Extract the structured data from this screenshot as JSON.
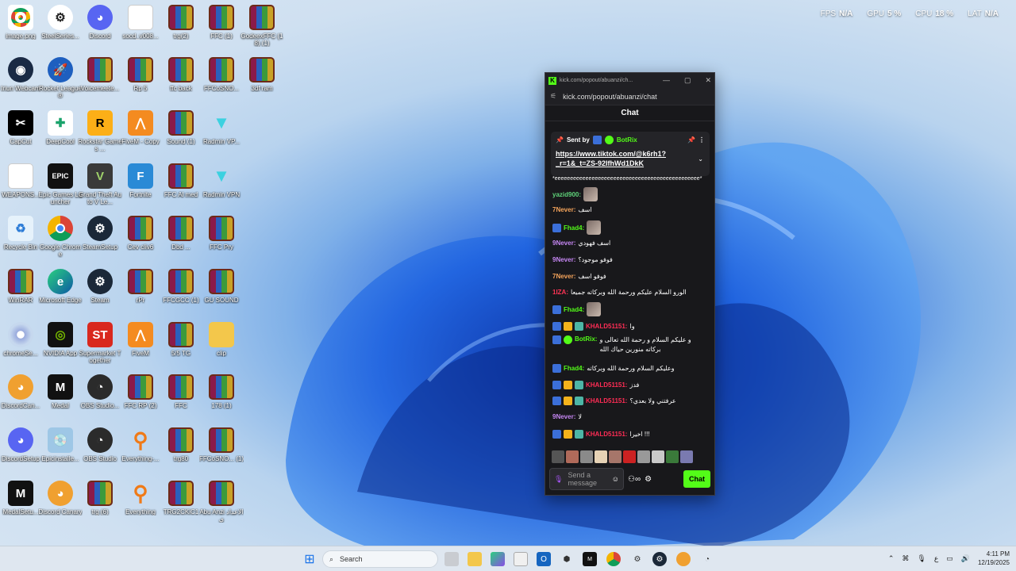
{
  "perf": {
    "fps_label": "FPS",
    "fps_value": "N/A",
    "gpu_label": "GPU",
    "gpu_value": "5 %",
    "cpu_label": "CPU",
    "cpu_value": "18 %",
    "lat_label": "LAT",
    "lat_value": "N/A"
  },
  "desktop_icons": [
    {
      "label": "image.png",
      "icon": "chrome-icon"
    },
    {
      "label": "SteelSeries...",
      "icon": "steelseries-icon"
    },
    {
      "label": "Discord",
      "icon": "discord-icon"
    },
    {
      "label": "socd_v008...",
      "icon": "file-icon"
    },
    {
      "label": "trg(2)",
      "icon": "rar-icon"
    },
    {
      "label": "FFC (1)",
      "icon": "rar-icon"
    },
    {
      "label": "GodeexFFC (18) (1)",
      "icon": "rar-icon"
    },
    {
      "label": "Iriun Webcam",
      "icon": "iriun-icon"
    },
    {
      "label": "Rocket League®",
      "icon": "rocket-league-icon"
    },
    {
      "label": "Voicemeete...",
      "icon": "rar-icon"
    },
    {
      "label": "Rp 5",
      "icon": "rar-icon"
    },
    {
      "label": "ffc back",
      "icon": "rar-icon"
    },
    {
      "label": "FFCoSNO...",
      "icon": "rar-icon"
    },
    {
      "label": "3df ram",
      "icon": "rar-icon"
    },
    {
      "label": "CapCut",
      "icon": "capcut-icon"
    },
    {
      "label": "DeepCool",
      "icon": "deepcool-icon"
    },
    {
      "label": "Rockstar Games ...",
      "icon": "rockstar-icon"
    },
    {
      "label": "FiveM - Copy",
      "icon": "fivem-icon"
    },
    {
      "label": "Sound (1)",
      "icon": "rar-icon"
    },
    {
      "label": "Radmin VP...",
      "icon": "radmin-icon"
    },
    {
      "label": "WEAPONS...",
      "icon": "file-icon"
    },
    {
      "label": "Epic Games Launcher",
      "icon": "epic-icon"
    },
    {
      "label": "Grand Theft Auto V Le...",
      "icon": "gta-icon"
    },
    {
      "label": "Fortnite",
      "icon": "fortnite-icon"
    },
    {
      "label": "FFC Al med",
      "icon": "rar-icon"
    },
    {
      "label": "Radmin VPN",
      "icon": "radmin-icon"
    },
    {
      "label": "Recycle Bin",
      "icon": "recycle-bin-icon"
    },
    {
      "label": "Google Chrome",
      "icon": "chrome-icon"
    },
    {
      "label": "SteamSetup",
      "icon": "steam-icon"
    },
    {
      "label": "Cev cliv6",
      "icon": "rar-icon"
    },
    {
      "label": "Dbd ...",
      "icon": "rar-icon"
    },
    {
      "label": "FFC Pry",
      "icon": "rar-icon"
    },
    {
      "label": "WinRAR",
      "icon": "rar-icon"
    },
    {
      "label": "Microsoft Edge",
      "icon": "edge-icon"
    },
    {
      "label": "Steam",
      "icon": "steam-icon"
    },
    {
      "label": "rPr",
      "icon": "rar-icon"
    },
    {
      "label": "FFCGCC (1)",
      "icon": "rar-icon"
    },
    {
      "label": "GU SOUND",
      "icon": "rar-icon"
    },
    {
      "label": "chromeSe...",
      "icon": "cd-icon"
    },
    {
      "label": "NVIDIA App",
      "icon": "nvidia-icon"
    },
    {
      "label": "Supermarket Together",
      "icon": "supermarket-icon"
    },
    {
      "label": "FiveM",
      "icon": "fivem-icon"
    },
    {
      "label": "5/5 TG",
      "icon": "rar-icon"
    },
    {
      "label": "clip",
      "icon": "folder-icon"
    },
    {
      "label": "DiscordCan...",
      "icon": "discord-icon"
    },
    {
      "label": "Medal",
      "icon": "medal-icon"
    },
    {
      "label": "OBS Studio...",
      "icon": "obs-icon"
    },
    {
      "label": "FFC RP (2)",
      "icon": "rar-icon"
    },
    {
      "label": "FFC",
      "icon": "rar-icon"
    },
    {
      "label": "178 (1)",
      "icon": "rar-icon"
    },
    {
      "label": "DiscordSetup",
      "icon": "discord-icon"
    },
    {
      "label": "Epicinstalle...",
      "icon": "installer-icon"
    },
    {
      "label": "OBS Studio",
      "icon": "obs-icon"
    },
    {
      "label": "Everything-...",
      "icon": "everything-icon"
    },
    {
      "label": "trg80",
      "icon": "rar-icon"
    },
    {
      "label": "FFCoSNO... (1)",
      "icon": "rar-icon"
    },
    {
      "label": "MedalSetu...",
      "icon": "medal-icon"
    },
    {
      "label": "Discord Canary",
      "icon": "discord-icon"
    },
    {
      "label": "trg (6)",
      "icon": "rar-icon"
    },
    {
      "label": "Everything",
      "icon": "everything-icon"
    },
    {
      "label": "TRG2CKiC1",
      "icon": "rar-icon"
    },
    {
      "label": "Abu Anzi الاعدادي",
      "icon": "rar-icon"
    }
  ],
  "chat_window": {
    "tab_title": "kick.com/popout/abuanzi/ch...",
    "url": "kick.com/popout/abuanzi/chat",
    "header": "Chat",
    "pinned": {
      "sent_by_label": "Sent by",
      "sender": "BotRix",
      "link": "https://www.tiktok.com/@k6rh1?_r=1&_t=ZS-92IfhWd1DkK"
    },
    "messages": [
      {
        "user": "",
        "text": "*eeeeeeeeeeeeeeeeeeeeeeeeeeeeeeeeeeeeeeeeeeeeeee*",
        "color": "#ffffff"
      },
      {
        "user": "yazid900:",
        "text": "",
        "color": "#5fd37a"
      },
      {
        "user": "7Never:",
        "text": "اسف",
        "color": "#f5a45b"
      },
      {
        "user": "Fhad4:",
        "text": "",
        "color": "#53fc18"
      },
      {
        "user": "9Never:",
        "text": "اسف فهودي",
        "color": "#c586f2"
      },
      {
        "user": "9Never:",
        "text": "فوفو موجود؟",
        "color": "#c586f2"
      },
      {
        "user": "7Never:",
        "text": "فوفو اسف",
        "color": "#f5a45b"
      },
      {
        "user": "1IZA:",
        "text": "الورو السلام عليكم ورحمة الله وبركاته جميعا",
        "color": "#ff3355"
      },
      {
        "user": "Fhad4:",
        "text": "",
        "color": "#53fc18"
      },
      {
        "user": "KHALD51151:",
        "text": "وا",
        "color": "#ff2d55"
      },
      {
        "user": "BotRix:",
        "text": "و عليكم السلام و رحمة الله تعالى و بركاته منورين حياك الله",
        "color": "#53fc18"
      },
      {
        "user": "Fhad4:",
        "text": "وعليكم السلام ورحمة الله وبركاته",
        "color": "#53fc18"
      },
      {
        "user": "KHALD51151:",
        "text": "فدز",
        "color": "#ff2d55"
      },
      {
        "user": "KHALD51151:",
        "text": "عرفتني ولا بعدي؟",
        "color": "#ff2d55"
      },
      {
        "user": "9Never:",
        "text": "لا",
        "color": "#c586f2"
      },
      {
        "user": "KHALD51151:",
        "text": "اخيرا !!!",
        "color": "#ff2d55"
      }
    ],
    "composer": {
      "placeholder": "Send a message",
      "send_label": "Chat"
    }
  },
  "taskbar": {
    "search_label": "Search",
    "lang": "ع",
    "time": "4:11 PM",
    "date": "12/19/2025"
  }
}
